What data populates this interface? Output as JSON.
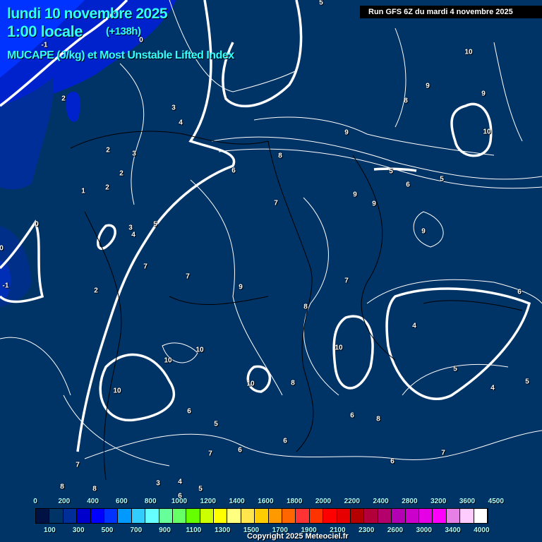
{
  "header": {
    "date": "lundi 10 novembre 2025",
    "time": "1:00 locale",
    "lead": "(+138h)",
    "parameter": "MUCAPE (J/kg) et Most Unstable Lifted Index",
    "run": "Run GFS 6Z du mardi 4 novembre 2025"
  },
  "contour_labels": [
    "5",
    "0",
    "-1",
    "2",
    "3",
    "4",
    "2",
    "3",
    "2",
    "1",
    "2",
    "0",
    "0",
    "-1",
    "3",
    "4",
    "5",
    "7",
    "2",
    "6",
    "8",
    "7",
    "9",
    "8",
    "9",
    "10",
    "9",
    "10",
    "5",
    "6",
    "5",
    "9",
    "9",
    "7",
    "9",
    "7",
    "9",
    "8",
    "6",
    "4",
    "5",
    "10",
    "10",
    "10",
    "10",
    "8",
    "6",
    "8",
    "5",
    "4",
    "5",
    "6",
    "7",
    "6",
    "7",
    "6",
    "10",
    "6",
    "8",
    "8",
    "7",
    "3",
    "4",
    "5",
    "6",
    "4"
  ],
  "legend": {
    "colors": [
      "#001144",
      "#003366",
      "#002e99",
      "#0000cc",
      "#0000ff",
      "#0033ff",
      "#0099ff",
      "#33ccff",
      "#66ffff",
      "#66ff99",
      "#66ff66",
      "#66ff00",
      "#ccff00",
      "#ffff00",
      "#ffff80",
      "#ffe64d",
      "#ffcc00",
      "#ff9900",
      "#ff6600",
      "#ff3333",
      "#ff3300",
      "#ff0000",
      "#e60000",
      "#b30000",
      "#b3003b",
      "#b3006b",
      "#b300b3",
      "#cc00cc",
      "#e600e6",
      "#ff00ff",
      "#e680e6",
      "#ffccff",
      "#ffffff"
    ],
    "top_ticks": [
      "0",
      "200",
      "400",
      "600",
      "800",
      "1000",
      "1200",
      "1400",
      "1600",
      "1800",
      "2000",
      "2200",
      "2400",
      "2800",
      "3200",
      "3600",
      "4500"
    ],
    "bottom_ticks": [
      "100",
      "300",
      "500",
      "700",
      "900",
      "1100",
      "1300",
      "1500",
      "1700",
      "1900",
      "2100",
      "2300",
      "2600",
      "3000",
      "3400",
      "4000"
    ]
  },
  "copyright": "Copyright 2025 Meteociel.fr"
}
